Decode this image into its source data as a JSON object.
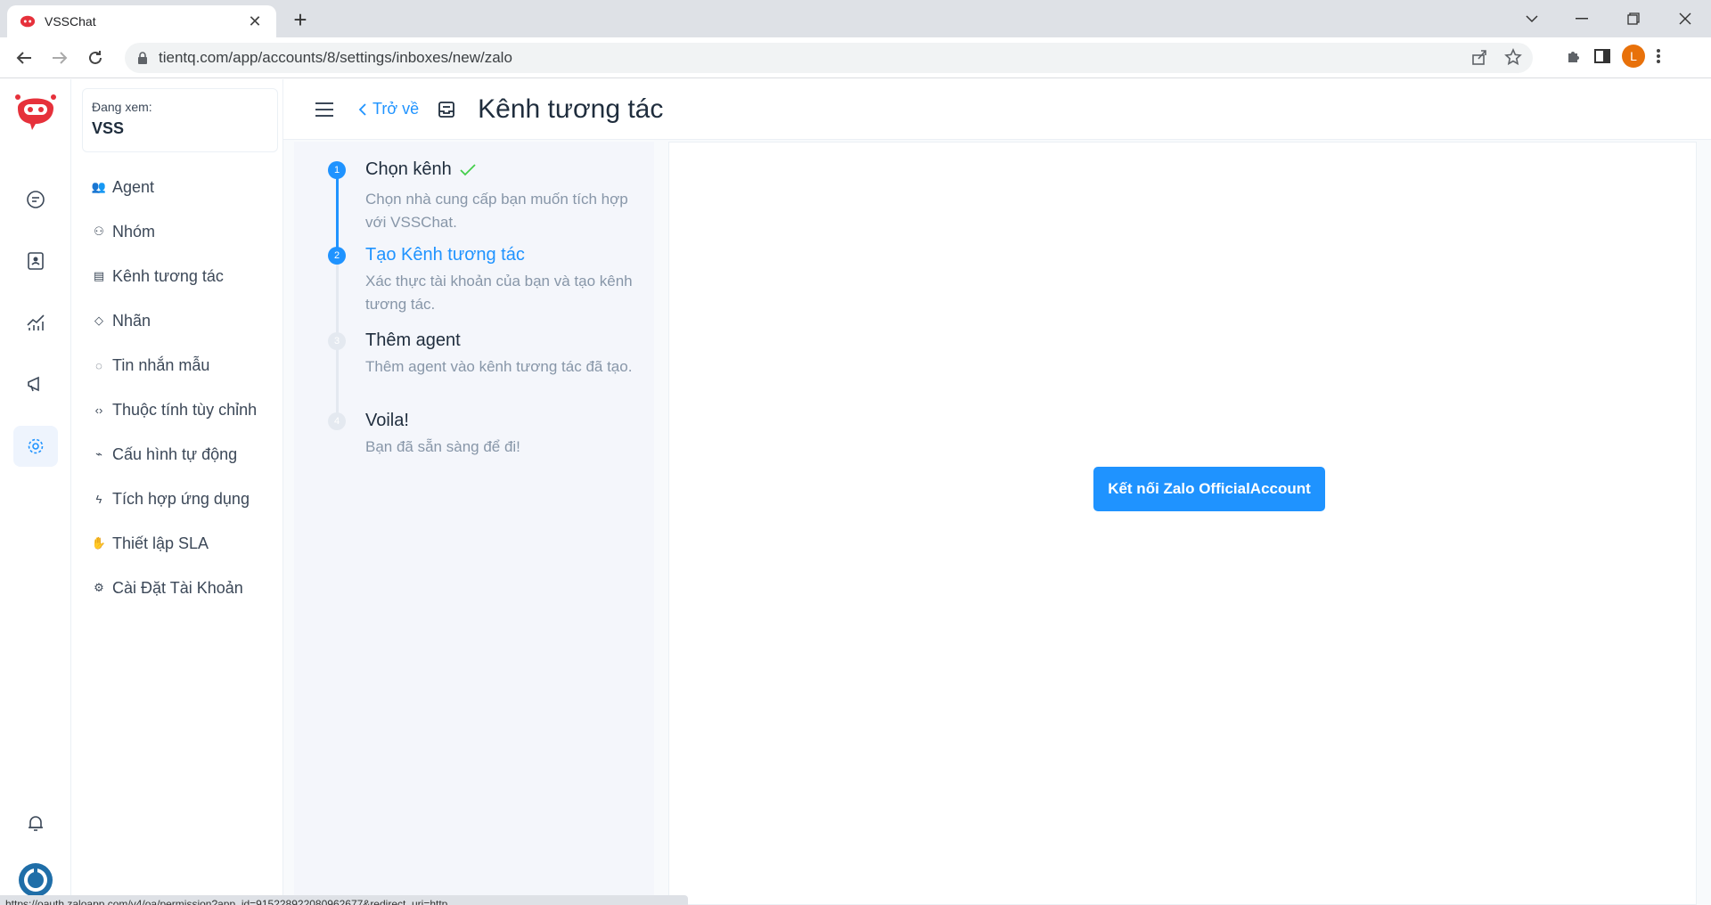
{
  "browser": {
    "tab_title": "VSSChat",
    "url": "tientq.com/app/accounts/8/settings/inboxes/new/zalo",
    "profile_initial": "L",
    "status_url": "https://oauth.zaloapp.com/v4/oa/permission?app_id=915228922080962677&redirect_uri=http..."
  },
  "settings_nav": {
    "viewing_label": "Đang xem:",
    "viewing_value": "VSS",
    "items": [
      {
        "label": "Agent",
        "icon": "people-icon"
      },
      {
        "label": "Nhóm",
        "icon": "team-icon"
      },
      {
        "label": "Kênh tương tác",
        "icon": "inbox-icon"
      },
      {
        "label": "Nhãn",
        "icon": "tag-icon"
      },
      {
        "label": "Tin nhắn mẫu",
        "icon": "chat-icon"
      },
      {
        "label": "Thuộc tính tùy chỉnh",
        "icon": "code-icon"
      },
      {
        "label": "Cấu hình tự động",
        "icon": "automation-icon"
      },
      {
        "label": "Tích hợp ứng dụng",
        "icon": "flash-icon"
      },
      {
        "label": "Thiết lập SLA",
        "icon": "handshake-icon"
      },
      {
        "label": "Cài Đặt Tài Khoản",
        "icon": "gear-icon"
      }
    ]
  },
  "header": {
    "back_label": "Trở về",
    "title": "Kênh tương tác"
  },
  "steps": [
    {
      "num": "1",
      "title": "Chọn kênh",
      "desc": "Chọn nhà cung cấp bạn muốn tích hợp với VSSChat.",
      "state": "done"
    },
    {
      "num": "2",
      "title": "Tạo Kênh tương tác",
      "desc": "Xác thực tài khoản của bạn và tạo kênh tương tác.",
      "state": "active"
    },
    {
      "num": "3",
      "title": "Thêm agent",
      "desc": "Thêm agent vào kênh tương tác đã tạo.",
      "state": "pending"
    },
    {
      "num": "4",
      "title": "Voila!",
      "desc": "Bạn đã sẵn sàng để đi!",
      "state": "pending"
    }
  ],
  "panel": {
    "connect_button": "Kết nối Zalo OfficialAccount"
  },
  "colors": {
    "accent": "#1f93ff",
    "brand_red": "#e6313b",
    "success": "#44ce4b"
  }
}
